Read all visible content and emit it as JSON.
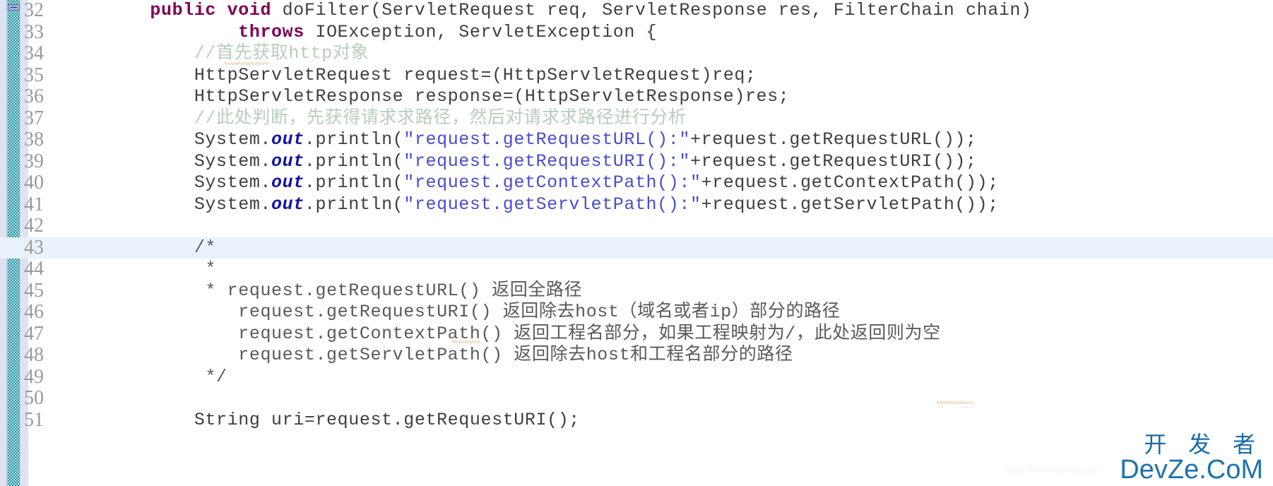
{
  "app": {
    "kind": "java-source-editor",
    "theme": "light"
  },
  "colors": {
    "background": "#ffffff",
    "gutter_background": "#dee3f0",
    "marker_bar": "#2c9aa8",
    "current_line_highlight": "#e9f2fb",
    "keyword": "#7f0055",
    "field": "#1414a0",
    "string": "#4b4bd0",
    "line_comment": "#b9cdbb",
    "block_comment": "#5a5a5a",
    "plain_text": "#3f3f3f",
    "line_number": "#9a9a9a",
    "watermark": "#1f72ad"
  },
  "editor": {
    "first_line_number": 32,
    "current_line_number": 43,
    "line_numbers": [
      32,
      33,
      34,
      35,
      36,
      37,
      38,
      39,
      40,
      41,
      42,
      43,
      44,
      45,
      46,
      47,
      48,
      49,
      50,
      51
    ],
    "lines": [
      {
        "n": 32,
        "current": false,
        "tokens": [
          {
            "t": "    ",
            "c": "plain"
          },
          {
            "t": "public void",
            "c": "kw"
          },
          {
            "t": " doFilter(ServletRequest req, ServletResponse res, FilterChain chain)",
            "c": "plain"
          }
        ]
      },
      {
        "n": 33,
        "current": false,
        "tokens": [
          {
            "t": "            ",
            "c": "plain"
          },
          {
            "t": "throws",
            "c": "kw"
          },
          {
            "t": " IOException, ServletException {",
            "c": "plain"
          }
        ]
      },
      {
        "n": 34,
        "current": false,
        "tokens": [
          {
            "t": "        ",
            "c": "plain"
          },
          {
            "t": "//首先获取http对象",
            "c": "cmt"
          }
        ]
      },
      {
        "n": 35,
        "current": false,
        "tokens": [
          {
            "t": "        HttpServletRequest request=(HttpServletRequest)req;",
            "c": "plain"
          }
        ]
      },
      {
        "n": 36,
        "current": false,
        "tokens": [
          {
            "t": "        HttpServletResponse response=(HttpServletResponse)res;",
            "c": "plain"
          }
        ]
      },
      {
        "n": 37,
        "current": false,
        "tokens": [
          {
            "t": "        ",
            "c": "plain"
          },
          {
            "t": "//此处判断，先获得请求求路径，然后对请求求路径进行分析",
            "c": "cmt"
          }
        ]
      },
      {
        "n": 38,
        "current": false,
        "tokens": [
          {
            "t": "        System.",
            "c": "plain"
          },
          {
            "t": "out",
            "c": "fld"
          },
          {
            "t": ".println(",
            "c": "plain"
          },
          {
            "t": "\"request.getRequestURL():\"",
            "c": "str"
          },
          {
            "t": "+request.getRequestURL());",
            "c": "plain"
          }
        ]
      },
      {
        "n": 39,
        "current": false,
        "tokens": [
          {
            "t": "        System.",
            "c": "plain"
          },
          {
            "t": "out",
            "c": "fld"
          },
          {
            "t": ".println(",
            "c": "plain"
          },
          {
            "t": "\"request.getRequestURI():\"",
            "c": "str"
          },
          {
            "t": "+request.getRequestURI());",
            "c": "plain"
          }
        ]
      },
      {
        "n": 40,
        "current": false,
        "tokens": [
          {
            "t": "        System.",
            "c": "plain"
          },
          {
            "t": "out",
            "c": "fld"
          },
          {
            "t": ".println(",
            "c": "plain"
          },
          {
            "t": "\"request.getContextPath():\"",
            "c": "str"
          },
          {
            "t": "+request.getContextPath());",
            "c": "plain"
          }
        ]
      },
      {
        "n": 41,
        "current": false,
        "tokens": [
          {
            "t": "        System.",
            "c": "plain"
          },
          {
            "t": "out",
            "c": "fld"
          },
          {
            "t": ".println(",
            "c": "plain"
          },
          {
            "t": "\"request.getServletPath():\"",
            "c": "str"
          },
          {
            "t": "+request.getServletPath());",
            "c": "plain"
          }
        ]
      },
      {
        "n": 42,
        "current": false,
        "tokens": [
          {
            "t": "",
            "c": "plain"
          }
        ]
      },
      {
        "n": 43,
        "current": true,
        "tokens": [
          {
            "t": "        ",
            "c": "plain"
          },
          {
            "t": "/*",
            "c": "bcmt"
          }
        ]
      },
      {
        "n": 44,
        "current": false,
        "tokens": [
          {
            "t": "         ",
            "c": "plain"
          },
          {
            "t": "*",
            "c": "bcmt"
          }
        ]
      },
      {
        "n": 45,
        "current": false,
        "tokens": [
          {
            "t": "         ",
            "c": "plain"
          },
          {
            "t": "* request.getRequestURL() 返回全路径",
            "c": "bcmt"
          }
        ]
      },
      {
        "n": 46,
        "current": false,
        "tokens": [
          {
            "t": "            ",
            "c": "plain"
          },
          {
            "t": "request.getRequestURI() 返回除去host（域名或者ip）部分的路径",
            "c": "bcmt"
          }
        ]
      },
      {
        "n": 47,
        "current": false,
        "tokens": [
          {
            "t": "            ",
            "c": "plain"
          },
          {
            "t": "request.getContextPath() 返回工程名部分，如果工程映射为/，此处返回则为空",
            "c": "bcmt"
          }
        ]
      },
      {
        "n": 48,
        "current": false,
        "tokens": [
          {
            "t": "            ",
            "c": "plain"
          },
          {
            "t": "request.getServletPath() 返回除去host和工程名部分的路径",
            "c": "bcmt"
          }
        ]
      },
      {
        "n": 49,
        "current": false,
        "tokens": [
          {
            "t": "         ",
            "c": "plain"
          },
          {
            "t": "*/",
            "c": "bcmt"
          }
        ]
      },
      {
        "n": 50,
        "current": false,
        "tokens": [
          {
            "t": "",
            "c": "plain"
          }
        ]
      },
      {
        "n": 51,
        "current": false,
        "tokens": [
          {
            "t": "        String uri=request.getRequestURI();",
            "c": "plain"
          }
        ]
      }
    ]
  },
  "watermark": {
    "cn": "开 发 者",
    "en": "DevZe.CoM",
    "faint": "https://www.devze.com"
  }
}
